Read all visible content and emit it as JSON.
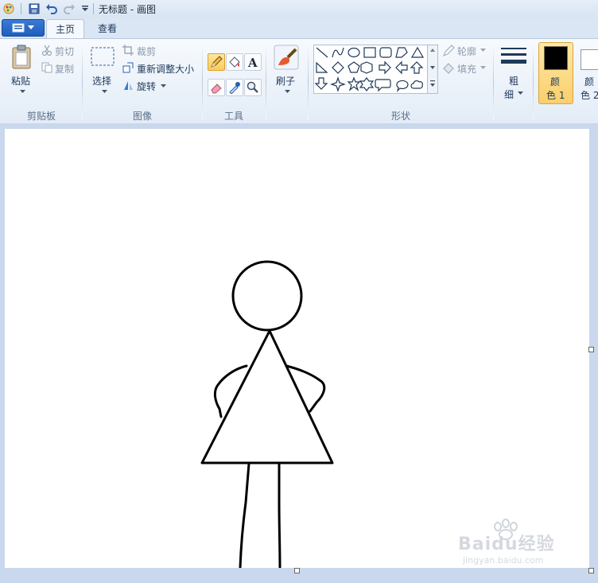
{
  "window": {
    "title": "无标题 - 画图"
  },
  "tabs": [
    {
      "label": "主页"
    },
    {
      "label": "查看"
    }
  ],
  "clipboard": {
    "paste": "粘贴",
    "cut": "剪切",
    "copy": "复制",
    "group": "剪贴板"
  },
  "image": {
    "select": "选择",
    "crop": "裁剪",
    "resize": "重新调整大小",
    "rotate": "旋转",
    "group": "图像"
  },
  "tools": {
    "group": "工具"
  },
  "brushes": {
    "label": "刷子"
  },
  "shapes": {
    "outline": "轮廓",
    "fill": "填充",
    "group": "形状"
  },
  "size": {
    "label_top": "粗",
    "label_bottom": "细"
  },
  "colors": {
    "color1_top": "颜",
    "color1_bottom": "色 1",
    "color1_value": "#000000",
    "color2_top": "颜",
    "color2_bottom": "色 2",
    "color2_value": "#ffffff"
  },
  "watermark": {
    "brand": "Baidu经验",
    "url": "jingyan.baidu.com"
  }
}
